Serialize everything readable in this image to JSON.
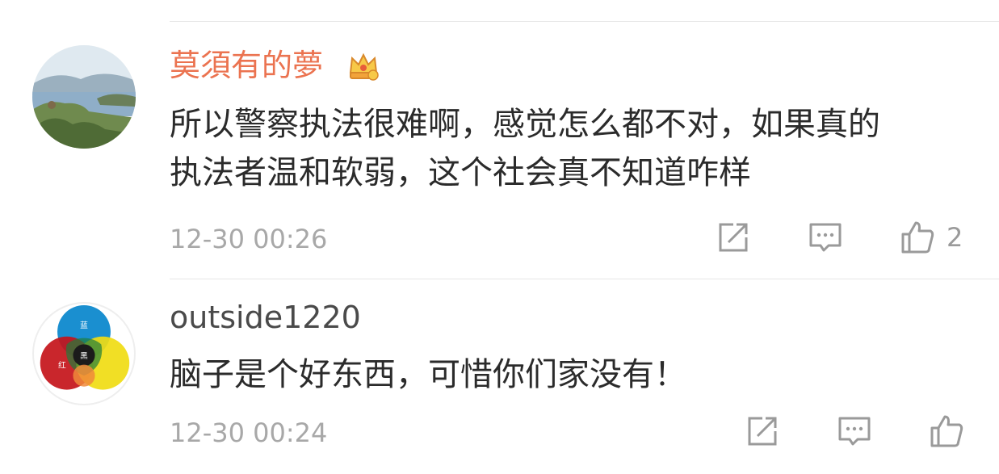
{
  "comments": [
    {
      "username": "莫須有的夢",
      "avatar": "landscape-lake-avatar",
      "badge_icon": "vip-crown-icon",
      "text_lines": [
        "所以警察执法很难啊，感觉怎么都不对，如果真的",
        "执法者温和软弱，这个社会真不知道咋样"
      ],
      "timestamp": "12-30 00:26",
      "actions": {
        "repost_icon": "repost-icon",
        "reply_icon": "comment-icon",
        "like_icon": "thumbs-up-icon",
        "like_count": "2"
      }
    },
    {
      "username": "outside1220",
      "avatar": "color-circles-avatar",
      "avatar_glyphs": [
        "蓝",
        "黑",
        "红"
      ],
      "text_lines": [
        "脑子是个好东西，可惜你们家没有！"
      ],
      "timestamp": "12-30 00:24",
      "actions": {
        "repost_icon": "repost-icon",
        "reply_icon": "comment-icon",
        "like_icon": "thumbs-up-icon"
      }
    }
  ],
  "colors": {
    "vip_name": "#eb7350",
    "name": "#4a4a4a",
    "meta": "#a8a8a8",
    "icon": "#9a9a9a"
  }
}
